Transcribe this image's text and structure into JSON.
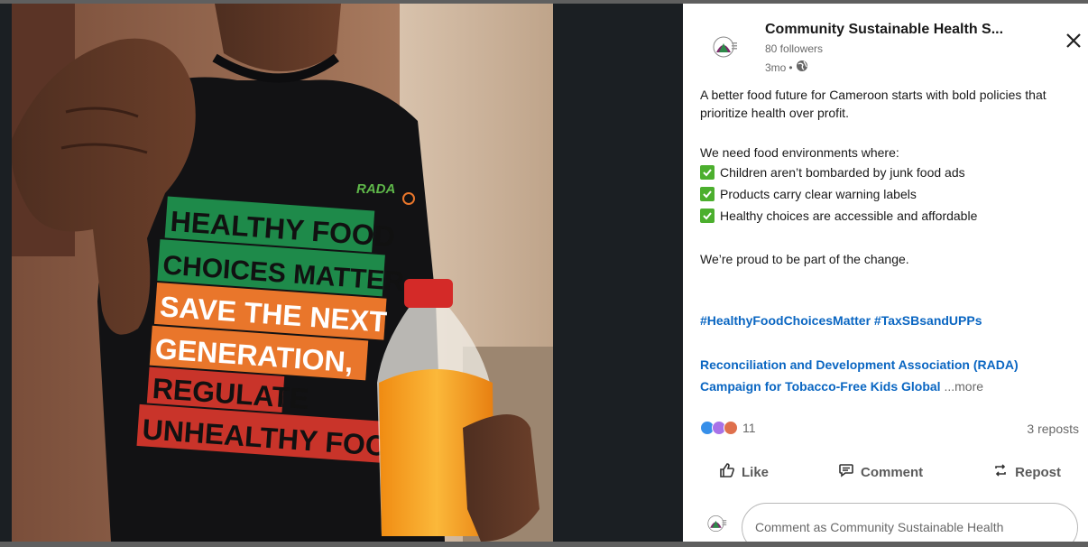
{
  "post": {
    "org_name": "Community Sustainable Health S...",
    "followers": "80 followers",
    "time": "3mo",
    "separator": "•",
    "intro": "A better food future for Cameroon starts with bold policies that prioritize health over profit.",
    "need_line": "We need food environments where:",
    "checks": [
      "Children aren’t bombarded by junk food ads",
      "Products carry clear warning labels",
      "Healthy choices are accessible and affordable"
    ],
    "proud_line": "We’re proud to be part of the change.",
    "hashtags": "#HealthyFoodChoicesMatter #TaxSBsandUPPs",
    "mention1": "Reconciliation and Development Association (RADA)",
    "mention2": "Campaign for Tobacco-Free Kids Global",
    "more": "...more"
  },
  "social": {
    "reaction_count": "11",
    "reposts": "3 reposts",
    "reaction_icons": [
      "like-reaction-icon",
      "support-reaction-icon",
      "love-reaction-icon"
    ]
  },
  "actions": {
    "like": "Like",
    "comment": "Comment",
    "repost": "Repost"
  },
  "comment": {
    "placeholder": "Comment as Community Sustainable Health"
  },
  "photo": {
    "rada_logo": "RADA",
    "shirt_lines": [
      "HEALTHY FOOD",
      "CHOICES MATTER",
      "SAVE THE NEXT",
      "GENERATION,",
      "REGULATE",
      "UNHEALTHY FOOD"
    ]
  },
  "colors": {
    "link": "#0a66c2",
    "check_bg": "#4caf2e",
    "shirt_green": "#1e8a4a",
    "shirt_orange": "#e9762b",
    "shirt_red": "#c9342a",
    "juice": "#f7a21b",
    "cap": "#d42a28"
  }
}
